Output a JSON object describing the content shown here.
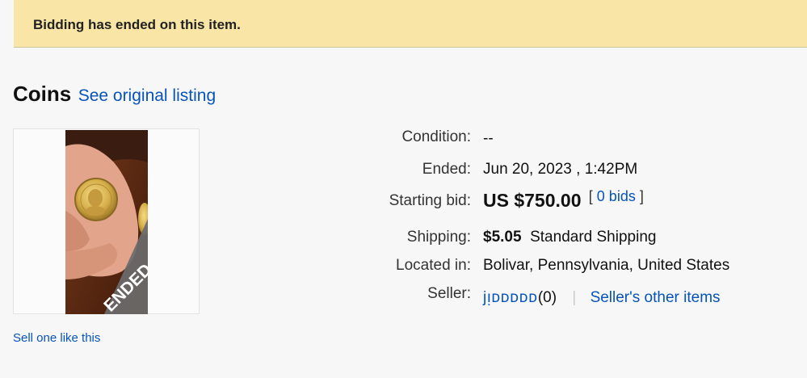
{
  "banner": {
    "message": "Bidding has ended on this item."
  },
  "listing": {
    "title": "Coins",
    "original_link": "See original listing",
    "image_badge": "ENDED"
  },
  "details": {
    "condition": {
      "label": "Condition:",
      "value": "--"
    },
    "ended": {
      "label": "Ended:",
      "value": "Jun 20, 2023 , 1:42PM"
    },
    "starting_bid": {
      "label": "Starting bid:",
      "value": "US $750.00",
      "bids_open": "[",
      "bids_link": "0 bids",
      "bids_close": "]"
    },
    "shipping": {
      "label": "Shipping:",
      "price": "$5.05",
      "method": "Standard Shipping"
    },
    "location": {
      "label": "Located in:",
      "value": "Bolivar, Pennsylvania, United States"
    },
    "seller": {
      "label": "Seller:",
      "name": "jᴉᴅᴅᴅᴅᴅ",
      "feedback": "(0)",
      "separator": "|",
      "other_items": "Seller's other items"
    }
  },
  "footer": {
    "sell_one_like_this": "Sell one like this"
  },
  "colors": {
    "banner_bg": "#f9e5a5",
    "link": "#0654ba",
    "badge_bg": "#6b6b6b"
  }
}
